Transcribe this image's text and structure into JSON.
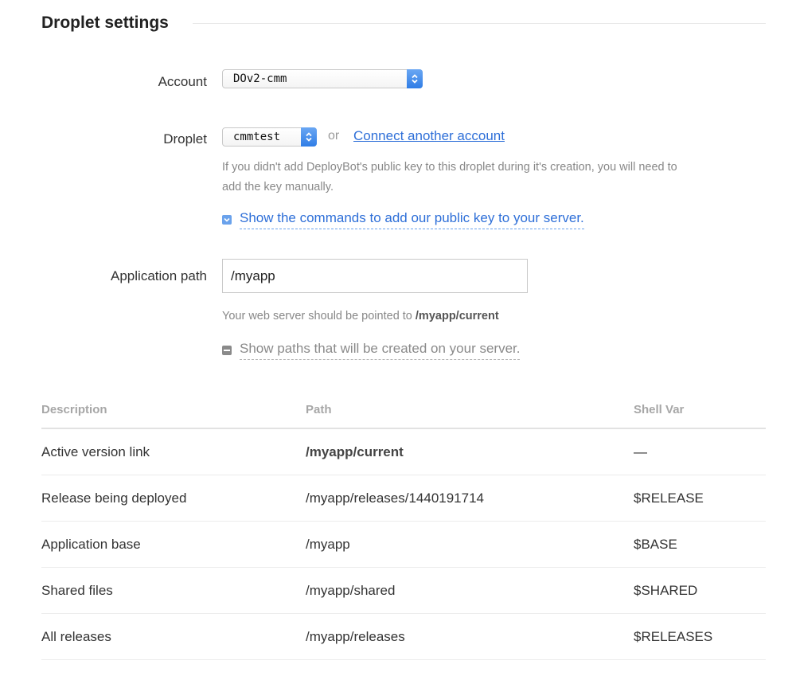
{
  "section": {
    "title": "Droplet settings"
  },
  "account": {
    "label": "Account",
    "value": "DOv2-cmm"
  },
  "droplet": {
    "label": "Droplet",
    "value": "cmmtest",
    "or_text": "or",
    "connect_link": "Connect another account",
    "help_line1": "If you didn't add DeployBot's public key to this droplet during it's creation, you will need to",
    "help_line2": "add the key manually.",
    "show_commands": "Show the commands to add our public key to your server."
  },
  "app_path": {
    "label": "Application path",
    "value": "/myapp",
    "help_prefix": "Your web server should be pointed to ",
    "help_path": "/myapp/current",
    "show_paths": "Show paths that will be created on your server."
  },
  "table": {
    "headers": [
      "Description",
      "Path",
      "Shell Var"
    ],
    "rows": [
      {
        "description": "Active version link",
        "path": "/myapp/current",
        "shell_var": "—"
      },
      {
        "description": "Release being deployed",
        "path": "/myapp/releases/1440191714",
        "shell_var": "$RELEASE"
      },
      {
        "description": "Application base",
        "path": "/myapp",
        "shell_var": "$BASE"
      },
      {
        "description": "Shared files",
        "path": "/myapp/shared",
        "shell_var": "$SHARED"
      },
      {
        "description": "All releases",
        "path": "/myapp/releases",
        "shell_var": "$RELEASES"
      }
    ]
  },
  "colors": {
    "link": "#2e6fd8",
    "select_arrow": "#3b85ea",
    "muted": "#888888"
  },
  "icons": {
    "select_arrow": "chevron-up-down-icon",
    "expanded_toggle": "chevron-down-icon",
    "collapsed_toggle": "minus-icon"
  }
}
